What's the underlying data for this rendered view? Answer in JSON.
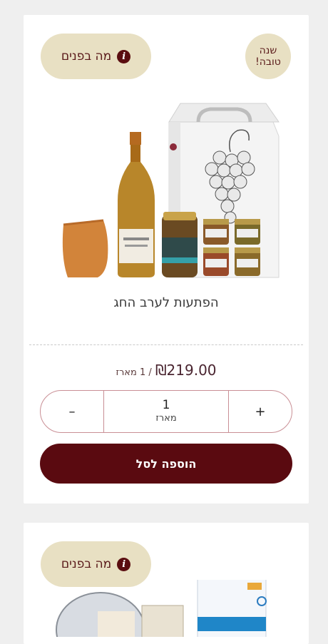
{
  "product1": {
    "info_label": "מה בפנים",
    "info_icon": "info-icon",
    "badge_line1": "שנה",
    "badge_line2": "טובה!",
    "title": "הפתעות לערב החג",
    "price": "₪219.00",
    "unit": "/ 1 מארז",
    "quantity": "1",
    "quantity_unit": "מארז",
    "minus": "–",
    "plus": "+",
    "add_to_cart": "הוספה לסל",
    "colors": {
      "accent": "#5a0a10",
      "pill": "#e8e0c3",
      "border": "#c98f95"
    }
  },
  "product2": {
    "info_label": "מה בפנים",
    "info_icon": "info-icon"
  }
}
